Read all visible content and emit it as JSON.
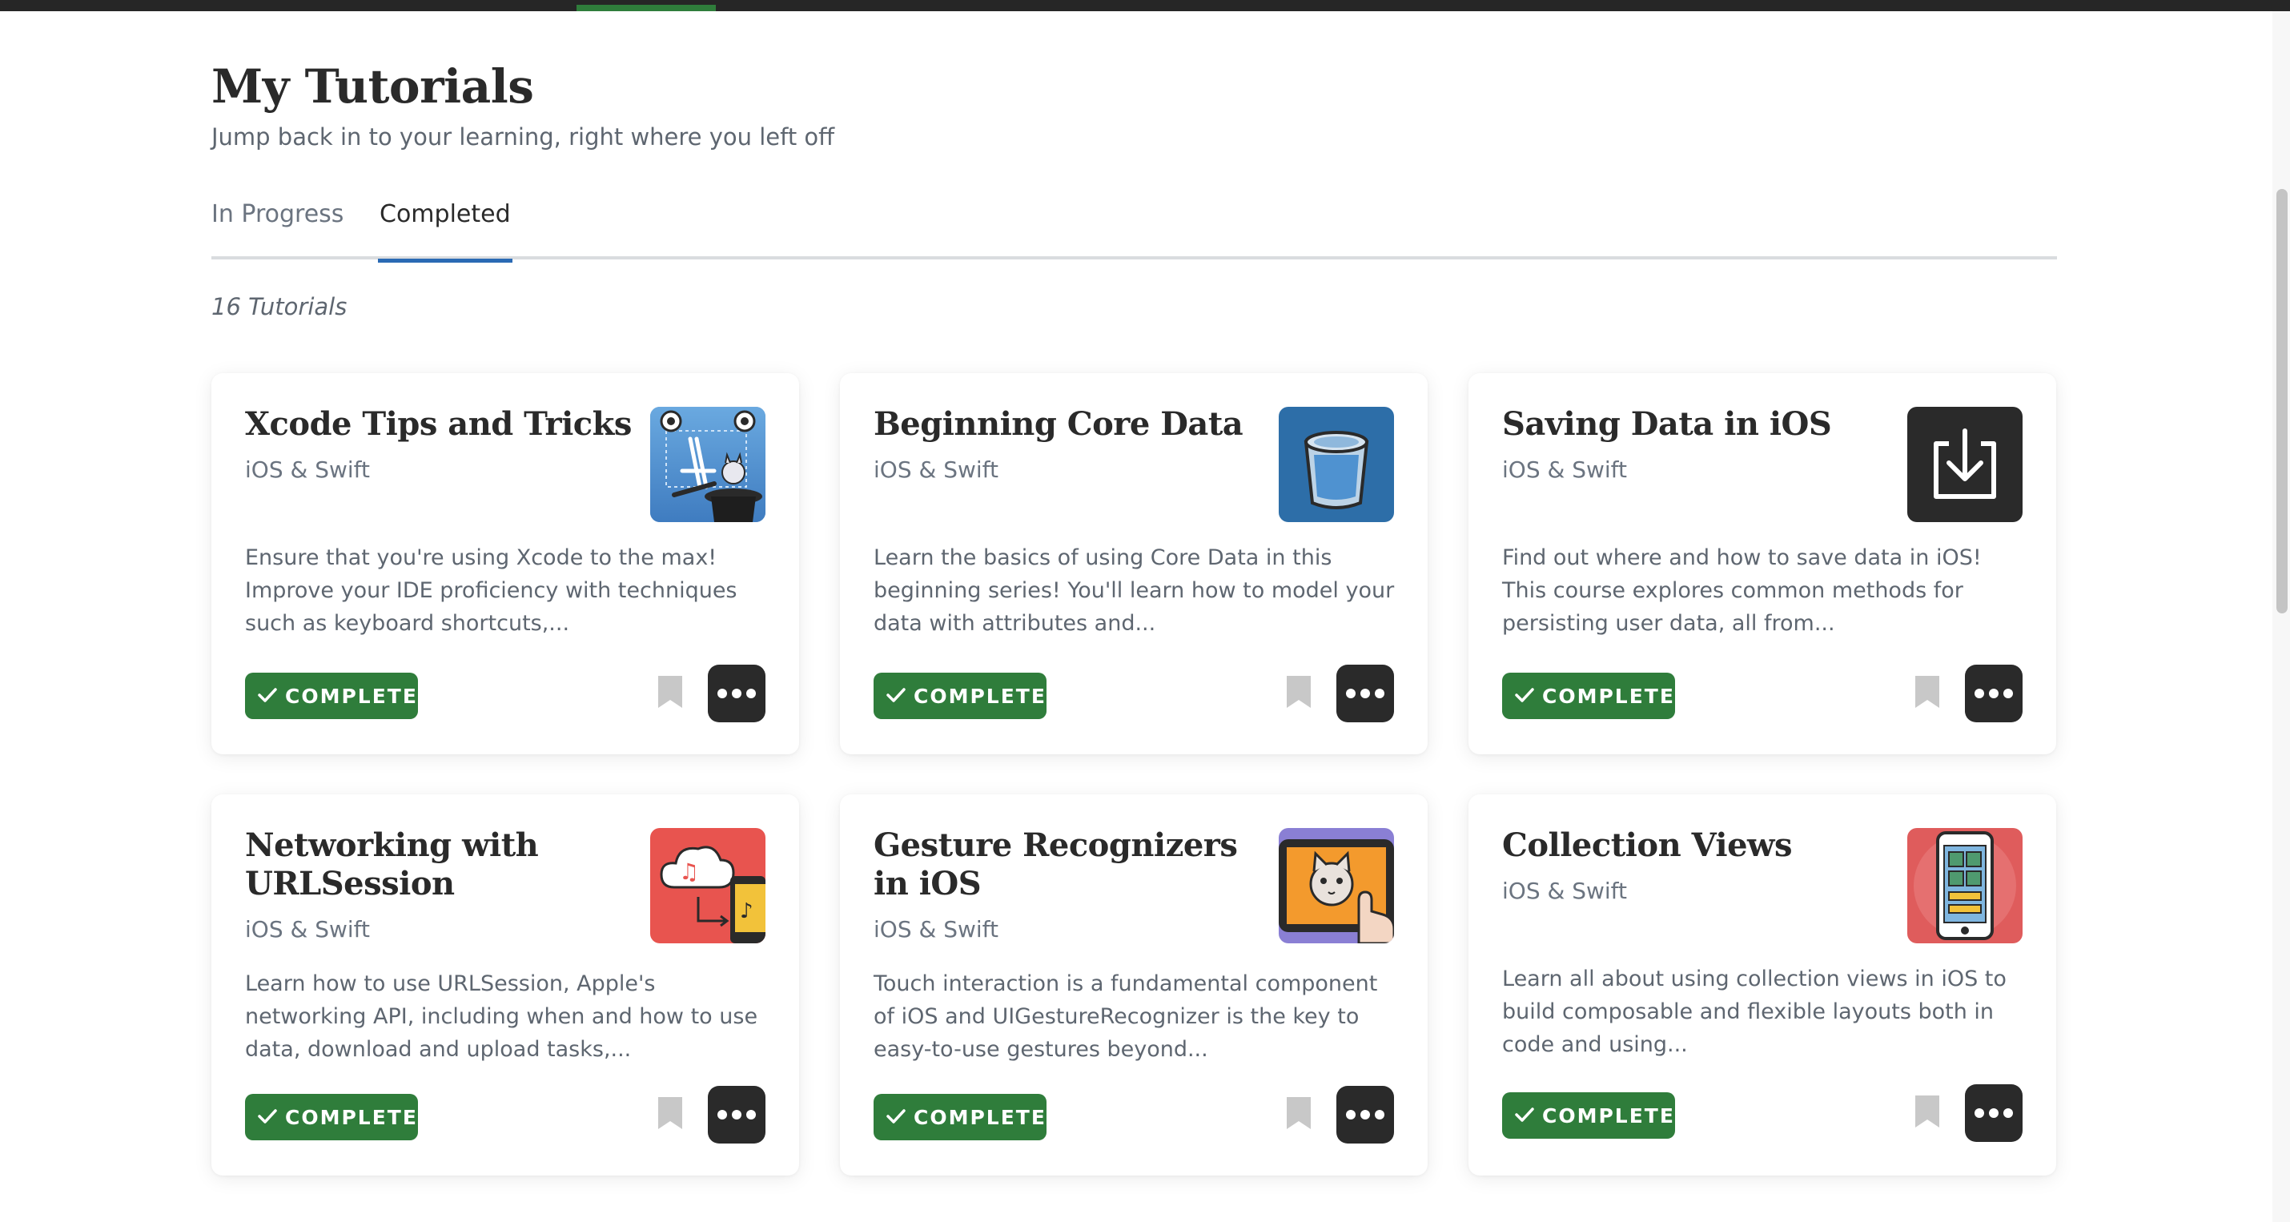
{
  "header": {
    "title": "My Tutorials",
    "subtitle": "Jump back in to your learning, right where you left off"
  },
  "tabs": [
    {
      "label": "In Progress",
      "active": false
    },
    {
      "label": "Completed",
      "active": true
    }
  ],
  "count_label": "16 Tutorials",
  "colors": {
    "accent_green": "#2f7d3b",
    "tab_underline": "#2a6ab4",
    "dark_button": "#2a2a2a"
  },
  "cards": [
    {
      "title": "Xcode Tips and Tricks",
      "domain": "iOS & Swift",
      "description": "Ensure that you're using Xcode to the max! Improve your IDE proficiency with techniques such as keyboard shortcuts,...",
      "status": "COMPLETED",
      "thumbnail_icon": "xcode-magic-hat-icon"
    },
    {
      "title": "Beginning Core Data",
      "domain": "iOS & Swift",
      "description": "Learn the basics of using Core Data in this beginning series! You'll learn how to model your data with attributes and...",
      "status": "COMPLETED",
      "thumbnail_icon": "database-bucket-icon"
    },
    {
      "title": "Saving Data in iOS",
      "domain": "iOS & Swift",
      "description": "Find out where and how to save data in iOS! This course explores common methods for persisting user data, all from...",
      "status": "COMPLETED",
      "thumbnail_icon": "save-download-icon"
    },
    {
      "title": "Networking with URLSession",
      "domain": "iOS & Swift",
      "description": "Learn how to use URLSession, Apple's networking API, including when and how to use data, download and upload tasks,...",
      "status": "COMPLETED",
      "thumbnail_icon": "cloud-music-phone-icon"
    },
    {
      "title": "Gesture Recognizers in iOS",
      "domain": "iOS & Swift",
      "description": "Touch interaction is a fundamental component of iOS and UIGestureRecognizer is the key to easy-to-use gestures beyond...",
      "status": "COMPLETED",
      "thumbnail_icon": "cat-tablet-touch-icon"
    },
    {
      "title": "Collection Views",
      "domain": "iOS & Swift",
      "description": "Learn all about using collection views in iOS to build composable and flexible layouts both in code and using...",
      "status": "COMPLETED",
      "thumbnail_icon": "phone-grid-icon"
    }
  ]
}
